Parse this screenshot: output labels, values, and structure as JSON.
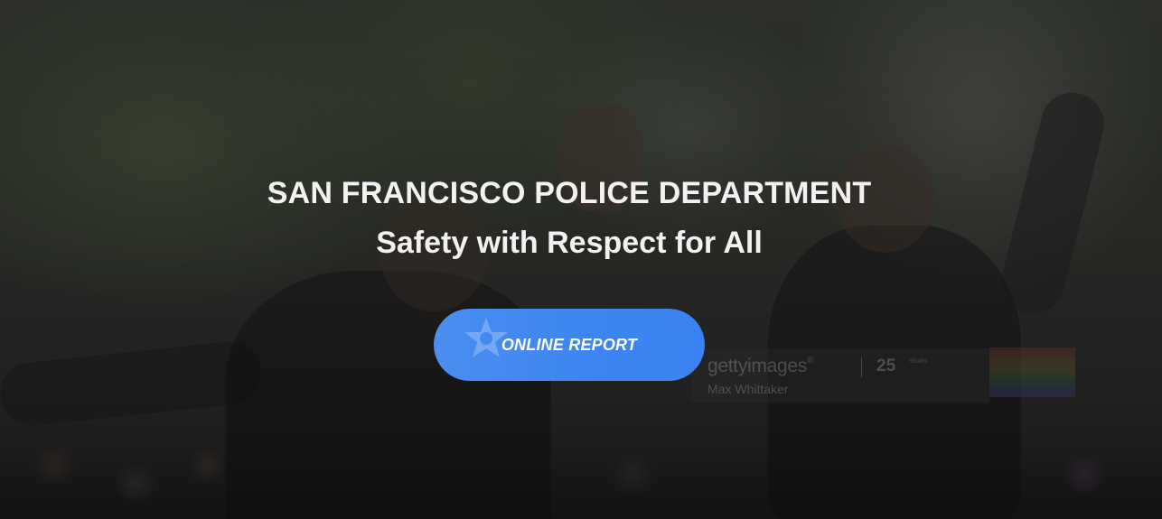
{
  "hero": {
    "title": "SAN FRANCISCO POLICE DEPARTMENT",
    "subtitle": "Safety with Respect for All",
    "cta_label": "ONLINE REPORT",
    "cta_icon": "police-star-badge-icon",
    "background_image": "police-officers-parade-photo"
  },
  "watermark": {
    "brand": "gettyimages",
    "registered": "®",
    "years": "25",
    "years_sub": "YEARS",
    "credit": "Max Whittaker"
  },
  "colors": {
    "cta_background": "#3d85f0",
    "title_text": "#f2f2f2",
    "overlay": "#0f0f0f"
  }
}
